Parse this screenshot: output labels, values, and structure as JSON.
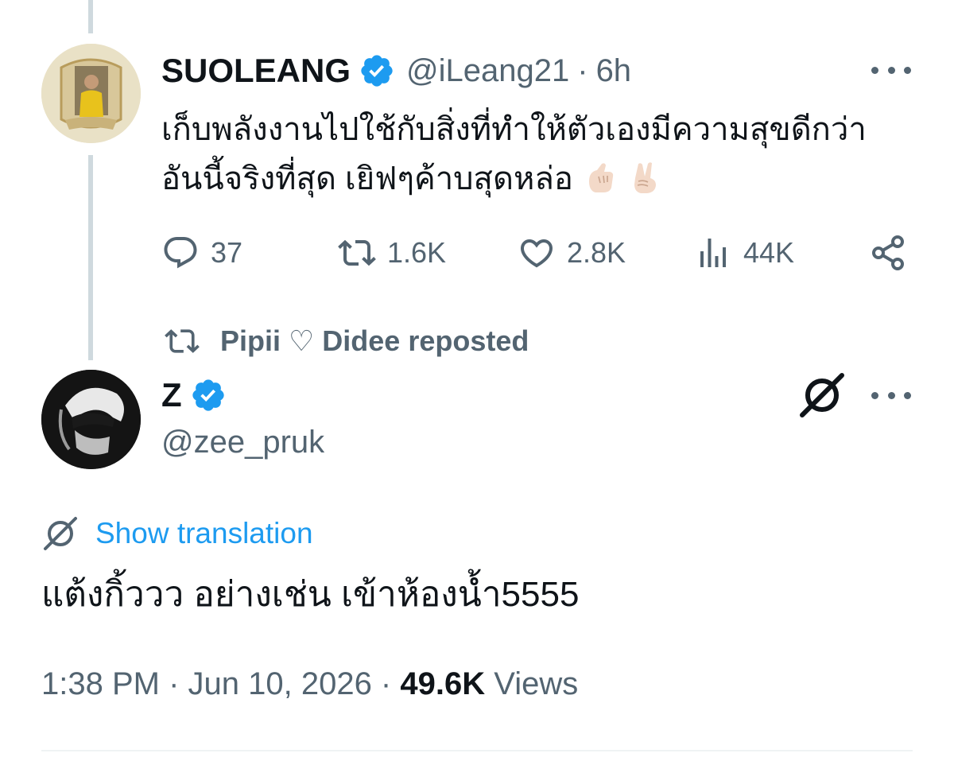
{
  "thread_post": {
    "display_name": "SUOLEANG",
    "handle": "@iLeang21",
    "separator": "·",
    "time": "6h",
    "text": "เก็บพลังงานไปใช้กับสิ่งที่ทำให้ตัวเองมีความสุขดีกว่า อันนี้จริงที่สุด เยิฟๆค้าบสุดหล่อ",
    "emojis": [
      "finger-heart-emoji",
      "victory-hand-emoji"
    ],
    "actions": {
      "replies": "37",
      "reposts": "1.6K",
      "likes": "2.8K",
      "views": "44K"
    }
  },
  "repost_notice": "Pipii ♡ Didee reposted",
  "main_post": {
    "display_name": "Z",
    "handle": "@zee_pruk",
    "show_translation": "Show translation",
    "text": "แต้งกิ้ววว อย่างเช่น เข้าห้องน้ำ5555",
    "timestamp": "1:38 PM · Jun 10, 2026 · ",
    "views_count": "49.6K",
    "views_label": " Views"
  },
  "colors": {
    "text_primary": "#0f1419",
    "text_secondary": "#536471",
    "accent": "#1d9bf0",
    "thread_line": "#cfd9de"
  }
}
